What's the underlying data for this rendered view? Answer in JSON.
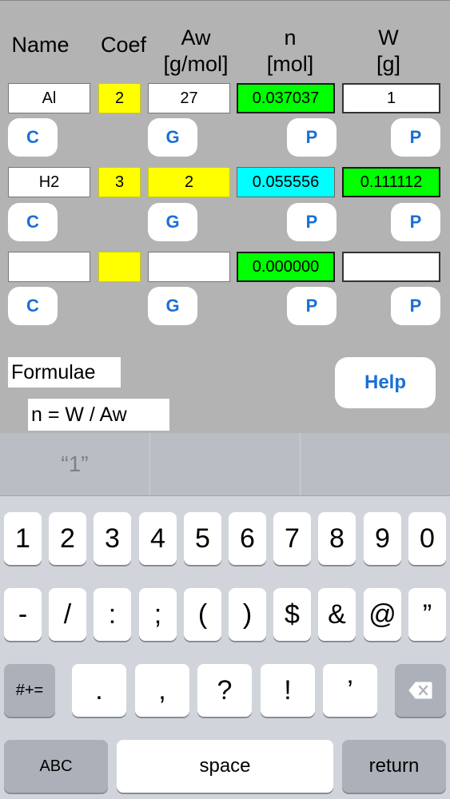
{
  "headers": {
    "name": "Name",
    "coef": "Coef",
    "aw": "Aw",
    "aw_unit": "[g/mol]",
    "n": "n",
    "n_unit": "[mol]",
    "w": "W",
    "w_unit": "[g]"
  },
  "rows": [
    {
      "name": "Al",
      "coef": "2",
      "aw": "27",
      "n": "0.037037",
      "w": "1"
    },
    {
      "name": "H2",
      "coef": "3",
      "aw": "2",
      "n": "0.055556",
      "w": "0.111112"
    },
    {
      "name": "",
      "coef": "",
      "aw": "",
      "n": "0.000000",
      "w": ""
    }
  ],
  "buttons": {
    "c": "C",
    "g": "G",
    "p": "P",
    "help": "Help"
  },
  "formulae": {
    "label": "Formulae",
    "formula": "n = W / Aw"
  },
  "colors": {
    "yellow": "#ffff00",
    "green": "#00ff00",
    "cyan": "#00ffff",
    "accent": "#1a6fd6"
  },
  "keyboard": {
    "suggestion": "“1”",
    "row1": [
      "1",
      "2",
      "3",
      "4",
      "5",
      "6",
      "7",
      "8",
      "9",
      "0"
    ],
    "row2": [
      "-",
      "/",
      ":",
      ";",
      "(",
      ")",
      "$",
      "&",
      "@",
      "”"
    ],
    "row3": [
      ".",
      ",",
      "?",
      "!",
      "’"
    ],
    "symbols_key": "#+=",
    "delete_icon": "backspace-icon",
    "abc_key": "ABC",
    "space_key": "space",
    "return_key": "return"
  }
}
